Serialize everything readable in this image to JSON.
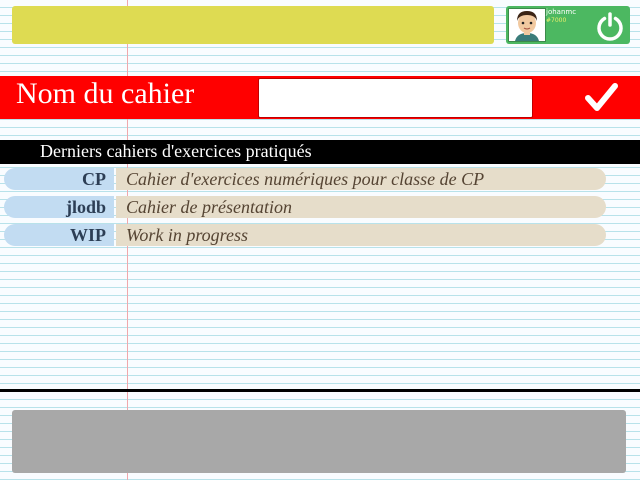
{
  "header": {
    "title_field": "",
    "user": {
      "name": "johanmc",
      "subtitle": "#7000",
      "avatar_icon": "boy-avatar-icon",
      "power_icon": "power-icon"
    }
  },
  "notebook_name": {
    "label": "Nom du cahier",
    "input_value": "",
    "placeholder": "",
    "confirm_icon": "checkmark-icon"
  },
  "recent": {
    "header": "Derniers cahiers d'exercices pratiqués",
    "items": [
      {
        "code": "CP",
        "description": "Cahier d'exercices numériques pour classe de CP"
      },
      {
        "code": "jlodb",
        "description": "Cahier de présentation"
      },
      {
        "code": "WIP",
        "description": "Work in progress"
      }
    ]
  },
  "colors": {
    "accent_red": "#ff0000",
    "title_yellow": "#dedb52",
    "user_green": "#4cb861",
    "code_blue": "#c2dcf2",
    "desc_beige": "#e6ddca",
    "footer_gray": "#a8a8a8"
  }
}
